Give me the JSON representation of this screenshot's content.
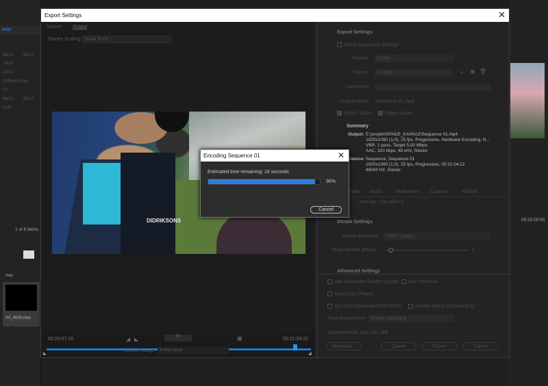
{
  "background": {
    "left_panel": {
      "tab": "mov",
      "values": [
        "960,0",
        "540,0",
        "100,0",
        "100,0",
        "Uniform Scale",
        "0,0",
        "960,0",
        "540,0",
        "0,00"
      ],
      "items_count": "1 of 6 Items",
      "bin_label": "mac",
      "clip_name": "IVI_4000.mov"
    },
    "right_panel": {
      "timecode": "00:25:00:00"
    }
  },
  "export_dialog": {
    "title": "Export Settings",
    "tabs": [
      "Source",
      "Output"
    ],
    "source_scaling_label": "Source Scaling",
    "source_scaling_value": "Scale To Fit",
    "preview_overlay_text": "DIDRIKSONS",
    "timeline": {
      "in_time": "00:20:07:16",
      "out_time": "00:21:04:22",
      "fit_label": "Fit",
      "source_range_label": "Source Range",
      "source_range_value": "Entire Work",
      "playhead_fraction": 0.94
    },
    "export_settings": {
      "heading": "Export Settings",
      "match_sequence": "Match Sequence Settings",
      "format_label": "Format:",
      "format_value": "H.264",
      "preset_label": "Preset:",
      "preset_value": "Custom",
      "comments_label": "Comments:",
      "output_name_label": "Output Name:",
      "output_name_value": "Sequence 01.mp4",
      "export_video": "Export Video",
      "export_audio": "Export Audio",
      "summary_heading": "Summary",
      "summary_output_label": "Output:",
      "summary_output_lines": [
        "E:\\projekt\\SPADE_KAVKAZ\\Sequence 01.mp4",
        "1920x1080 (1,0), 25 fps, Progressive, Hardware Encoding, N...",
        "VBR, 1 pass, Target 5,00 Mbps",
        "AAC, 320 kbps, 48 kHz, Stereo"
      ],
      "summary_source_label": "Source:",
      "summary_source_lines": [
        "Sequence, Sequence 01",
        "1920x1080 (1,0), 25 fps, Progressive, 00:21:04:22",
        "48000 Hz, Stereo"
      ]
    },
    "settings_tabs": [
      "Video",
      "Audio",
      "Multiplexer",
      "Captions",
      "Publish"
    ],
    "average_label": "Average: 200 cd/m^2",
    "bitrate": {
      "heading": "Bitrate Settings",
      "encoding_label": "Bitrate Encoding:",
      "encoding_value": "VBR, 1 pass",
      "target_label": "Target Bitrate [Mbps]:",
      "target_value": "5"
    },
    "advanced": {
      "heading": "Advanced Settings",
      "max_render_quality": "Use Maximum Render Quality",
      "use_previews": "Use Previews",
      "import_into_project": "Import into Project",
      "set_start_timecode": "Set Start Timecode",
      "start_timecode_value": "00:00:00:00",
      "render_alpha": "Render Alpha Channel Only",
      "time_interpolation_label": "Time Interpolation:",
      "time_interpolation_value": "Frame Sampling",
      "file_size_label": "Estimated File Size:",
      "file_size_value": "841 MB"
    },
    "buttons": [
      "Metadata...",
      "Queue",
      "Export",
      "Cancel"
    ]
  },
  "encoding_modal": {
    "title": "Encoding Sequence 01",
    "eta": "Estimated time remaining: 16 seconds",
    "progress_pct": 96,
    "progress_label": "96%",
    "cancel_label": "Cancel",
    "progress_color": "#2f7de0"
  }
}
